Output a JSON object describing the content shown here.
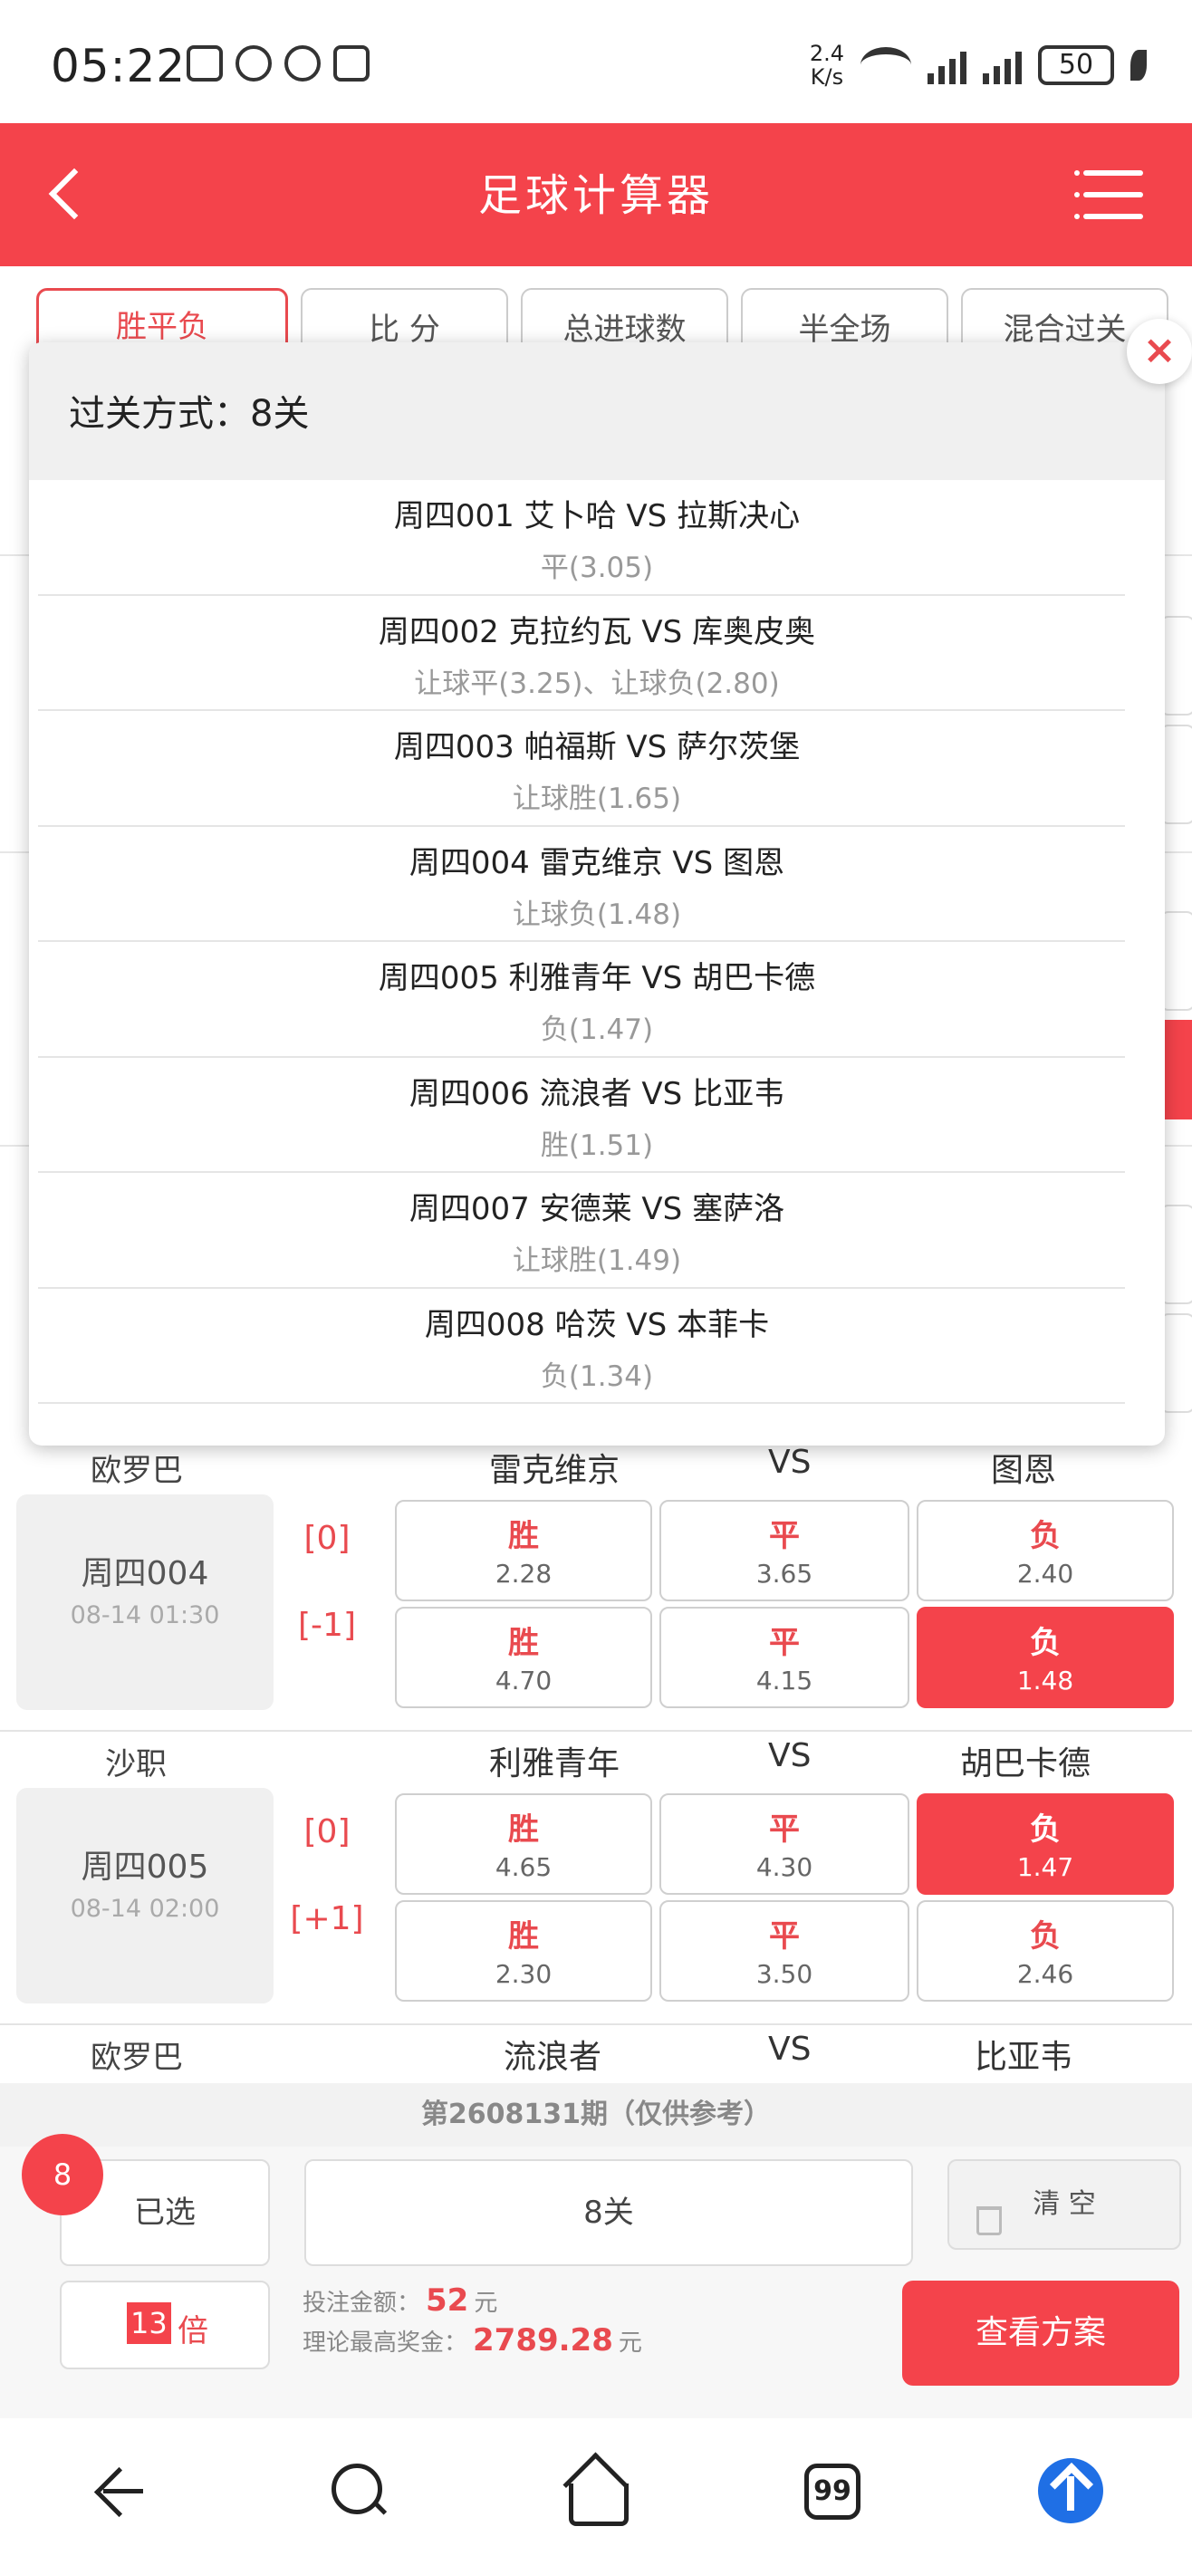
{
  "status_bar": {
    "time": "05:22",
    "net_speed_value": "2.4",
    "net_speed_unit": "K/s",
    "battery": "50"
  },
  "header": {
    "title": "足球计算器"
  },
  "tabs": [
    {
      "label": "胜平负"
    },
    {
      "label": "比 分"
    },
    {
      "label": "总进球数"
    },
    {
      "label": "半全场"
    },
    {
      "label": "混合过关"
    }
  ],
  "popup": {
    "title": "过关方式：8关",
    "items": [
      {
        "match": "周四001 艾卜哈 VS 拉斯决心",
        "pick": "平(3.05)"
      },
      {
        "match": "周四002 克拉约瓦 VS 库奥皮奥",
        "pick": "让球平(3.25)、让球负(2.80)"
      },
      {
        "match": "周四003 帕福斯 VS 萨尔茨堡",
        "pick": "让球胜(1.65)"
      },
      {
        "match": "周四004 雷克维京 VS 图恩",
        "pick": "让球负(1.48)"
      },
      {
        "match": "周四005 利雅青年 VS 胡巴卡德",
        "pick": "负(1.47)"
      },
      {
        "match": "周四006 流浪者 VS 比亚韦",
        "pick": "胜(1.51)"
      },
      {
        "match": "周四007 安德莱 VS 塞萨洛",
        "pick": "让球胜(1.49)"
      },
      {
        "match": "周四008 哈茨 VS 本菲卡",
        "pick": "负(1.34)"
      }
    ]
  },
  "matches": [
    {
      "league": "欧罗巴",
      "home": "雷克维京",
      "vs": "VS",
      "away": "图恩",
      "day": "周四004",
      "time": "08-14 01:30",
      "rows": [
        {
          "handicap": "[0]",
          "odds": [
            {
              "result": "胜",
              "value": "2.28",
              "selected": false
            },
            {
              "result": "平",
              "value": "3.65",
              "selected": false
            },
            {
              "result": "负",
              "value": "2.40",
              "selected": false
            }
          ]
        },
        {
          "handicap": "[-1]",
          "odds": [
            {
              "result": "胜",
              "value": "4.70",
              "selected": false
            },
            {
              "result": "平",
              "value": "4.15",
              "selected": false
            },
            {
              "result": "负",
              "value": "1.48",
              "selected": true
            }
          ]
        }
      ]
    },
    {
      "league": "沙职",
      "home": "利雅青年",
      "vs": "VS",
      "away": "胡巴卡德",
      "day": "周四005",
      "time": "08-14 02:00",
      "rows": [
        {
          "handicap": "[0]",
          "odds": [
            {
              "result": "胜",
              "value": "4.65",
              "selected": false
            },
            {
              "result": "平",
              "value": "4.30",
              "selected": false
            },
            {
              "result": "负",
              "value": "1.47",
              "selected": true
            }
          ]
        },
        {
          "handicap": "[+1]",
          "odds": [
            {
              "result": "胜",
              "value": "2.30",
              "selected": false
            },
            {
              "result": "平",
              "value": "3.50",
              "selected": false
            },
            {
              "result": "负",
              "value": "2.46",
              "selected": false
            }
          ]
        }
      ]
    }
  ],
  "next_match": {
    "league": "欧罗巴",
    "home": "流浪者",
    "vs": "VS",
    "away": "比亚韦"
  },
  "period_notice": "第2608131期（仅供参考）",
  "action": {
    "selected_count": "8",
    "selected_label": "已选",
    "pass_type": "8关",
    "clear_label": "清 空",
    "multiplier_value": "13",
    "multiplier_unit": "倍",
    "bet_amount_label": "投注金额：",
    "bet_amount_value": "52",
    "bet_amount_unit": "元",
    "max_prize_label": "理论最高奖金：",
    "max_prize_value": "2789.28",
    "max_prize_unit": "元",
    "view_plan_label": "查看方案"
  },
  "nav": {
    "tabs_count": "99"
  },
  "colors": {
    "brand_red": "#f4434b",
    "accent_text_red": "#e94a4f",
    "upload_blue": "#1f6fe5"
  }
}
